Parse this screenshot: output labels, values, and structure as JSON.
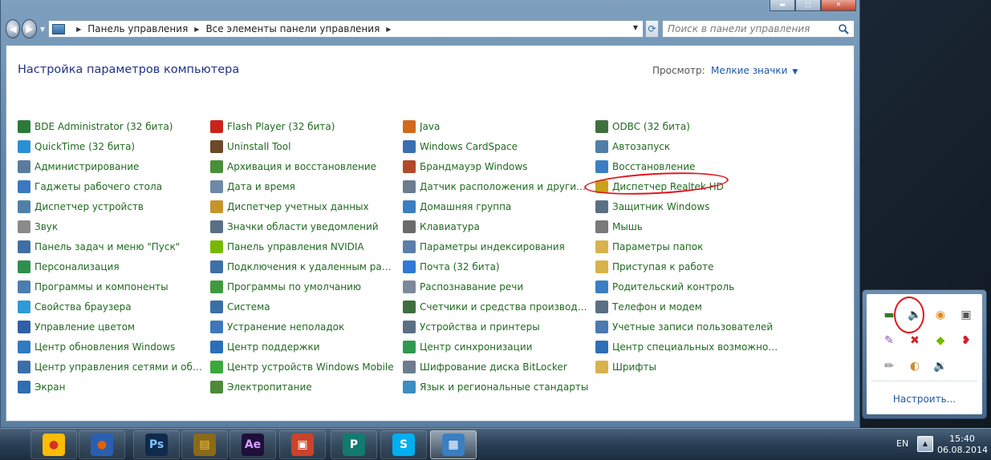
{
  "window": {
    "address": {
      "crumbs": [
        "Панель управления",
        "Все элементы панели управления"
      ]
    },
    "search": {
      "placeholder": "Поиск в панели управления"
    }
  },
  "content": {
    "title": "Настройка параметров компьютера",
    "view_label": "Просмотр:",
    "view_value": "Мелкие значки",
    "items": [
      {
        "label": "BDE Administrator (32 бита)",
        "icon": "bde-icon",
        "color": "#2a7a3a"
      },
      {
        "label": "QuickTime (32 бита)",
        "icon": "quicktime-icon",
        "color": "#2b8fd6"
      },
      {
        "label": "Администрирование",
        "icon": "admin-tools-icon",
        "color": "#5a7b9b"
      },
      {
        "label": "Гаджеты рабочего стола",
        "icon": "gadgets-icon",
        "color": "#3a78c2"
      },
      {
        "label": "Диспетчер устройств",
        "icon": "device-manager-icon",
        "color": "#4f7fa8"
      },
      {
        "label": "Звук",
        "icon": "sound-icon",
        "color": "#8a8a8a"
      },
      {
        "label": "Панель задач и меню \"Пуск\"",
        "icon": "taskbar-icon",
        "color": "#3d6fa6"
      },
      {
        "label": "Персонализация",
        "icon": "personalization-icon",
        "color": "#2f8f4f"
      },
      {
        "label": "Программы и компоненты",
        "icon": "programs-icon",
        "color": "#4c7db0"
      },
      {
        "label": "Свойства браузера",
        "icon": "browser-properties-icon",
        "color": "#2f9ad6"
      },
      {
        "label": "Управление цветом",
        "icon": "color-management-icon",
        "color": "#2f5fa6"
      },
      {
        "label": "Центр обновления Windows",
        "icon": "windows-update-icon",
        "color": "#2f7ac2"
      },
      {
        "label": "Центр управления сетями и общи...",
        "icon": "network-center-icon",
        "color": "#3a6fa8"
      },
      {
        "label": "Экран",
        "icon": "display-icon",
        "color": "#2f6fb0"
      },
      {
        "label": "Flash Player (32 бита)",
        "icon": "flash-icon",
        "color": "#c9241c"
      },
      {
        "label": "Uninstall Tool",
        "icon": "uninstall-tool-icon",
        "color": "#6b4a2a"
      },
      {
        "label": "Архивация и восстановление",
        "icon": "backup-icon",
        "color": "#4a8f3a"
      },
      {
        "label": "Дата и время",
        "icon": "date-time-icon",
        "color": "#6d8aa8"
      },
      {
        "label": "Диспетчер учетных данных",
        "icon": "credential-manager-icon",
        "color": "#c4962a"
      },
      {
        "label": "Значки области уведомлений",
        "icon": "notification-icons-icon",
        "color": "#5a6f86"
      },
      {
        "label": "Панель управления NVIDIA",
        "icon": "nvidia-icon",
        "color": "#76b900"
      },
      {
        "label": "Подключения к удаленным рабоч...",
        "icon": "remote-desktop-icon",
        "color": "#3f6fa8"
      },
      {
        "label": "Программы по умолчанию",
        "icon": "default-programs-icon",
        "color": "#3f9a3f"
      },
      {
        "label": "Система",
        "icon": "system-icon",
        "color": "#3a6fa6"
      },
      {
        "label": "Устранение неполадок",
        "icon": "troubleshooting-icon",
        "color": "#3f77b8"
      },
      {
        "label": "Центр поддержки",
        "icon": "action-center-icon",
        "color": "#2a6fb8"
      },
      {
        "label": "Центр устройств Windows Mobile",
        "icon": "windows-mobile-icon",
        "color": "#3aa83a"
      },
      {
        "label": "Электропитание",
        "icon": "power-options-icon",
        "color": "#4c8a3a"
      },
      {
        "label": "Java",
        "icon": "java-icon",
        "color": "#d2691e"
      },
      {
        "label": "Windows CardSpace",
        "icon": "cardspace-icon",
        "color": "#3a6fb0"
      },
      {
        "label": "Брандмауэр Windows",
        "icon": "firewall-icon",
        "color": "#b04a2a"
      },
      {
        "label": "Датчик расположения и другие дат...",
        "icon": "location-sensor-icon",
        "color": "#6b7d8f"
      },
      {
        "label": "Домашняя группа",
        "icon": "homegroup-icon",
        "color": "#3a7fc2"
      },
      {
        "label": "Клавиатура",
        "icon": "keyboard-icon",
        "color": "#6b6b6b"
      },
      {
        "label": "Параметры индексирования",
        "icon": "indexing-icon",
        "color": "#5a7fa8"
      },
      {
        "label": "Почта (32 бита)",
        "icon": "mail-icon",
        "color": "#2f7ad6"
      },
      {
        "label": "Распознавание речи",
        "icon": "speech-recognition-icon",
        "color": "#7a8a9a"
      },
      {
        "label": "Счетчики и средства производител...",
        "icon": "performance-icon",
        "color": "#3f6f3f"
      },
      {
        "label": "Устройства и принтеры",
        "icon": "devices-printers-icon",
        "color": "#5a6f86"
      },
      {
        "label": "Центр синхронизации",
        "icon": "sync-center-icon",
        "color": "#2f9a4f"
      },
      {
        "label": "Шифрование диска BitLocker",
        "icon": "bitlocker-icon",
        "color": "#6b7d8f"
      },
      {
        "label": "Язык и региональные стандарты",
        "icon": "region-language-icon",
        "color": "#3a8fc2"
      },
      {
        "label": "ODBC (32 бита)",
        "icon": "odbc-icon",
        "color": "#3f6f3f"
      },
      {
        "label": "Автозапуск",
        "icon": "autoplay-icon",
        "color": "#4f7fa8"
      },
      {
        "label": "Восстановление",
        "icon": "recovery-icon",
        "color": "#3a7fc2"
      },
      {
        "label": "Диспетчер Realtek HD",
        "icon": "realtek-icon",
        "color": "#c8a21a"
      },
      {
        "label": "Защитник Windows",
        "icon": "windows-defender-icon",
        "color": "#5a6f86"
      },
      {
        "label": "Мышь",
        "icon": "mouse-icon",
        "color": "#7a7a7a"
      },
      {
        "label": "Параметры папок",
        "icon": "folder-options-icon",
        "color": "#d8b24a"
      },
      {
        "label": "Приступая к работе",
        "icon": "getting-started-icon",
        "color": "#d8b24a"
      },
      {
        "label": "Родительский контроль",
        "icon": "parental-controls-icon",
        "color": "#3a7fc2"
      },
      {
        "label": "Телефон и модем",
        "icon": "phone-modem-icon",
        "color": "#5a6f86"
      },
      {
        "label": "Учетные записи пользователей",
        "icon": "user-accounts-icon",
        "color": "#4a7ab0"
      },
      {
        "label": "Центр специальных возможностей",
        "icon": "ease-of-access-icon",
        "color": "#2f6fb8"
      },
      {
        "label": "Шрифты",
        "icon": "fonts-icon",
        "color": "#d8b24a"
      }
    ]
  },
  "tray": {
    "customize_label": "Настроить...",
    "icons": [
      "network-card-icon",
      "speaker-icon",
      "avast-icon",
      "usb-device-icon",
      "feather-icon",
      "error-device-icon",
      "nvidia-tray-icon",
      "lips-icon",
      "pen-icon",
      "weather-icon",
      "volume-icon"
    ]
  },
  "taskbar": {
    "apps": [
      "chrome-icon",
      "firefox-icon",
      "photoshop-icon",
      "explorer-icon",
      "after-effects-icon",
      "powerpoint-icon",
      "publisher-icon",
      "skype-icon",
      "control-panel-icon"
    ],
    "lang": "EN",
    "time": "15:40",
    "date": "06.08.2014"
  }
}
